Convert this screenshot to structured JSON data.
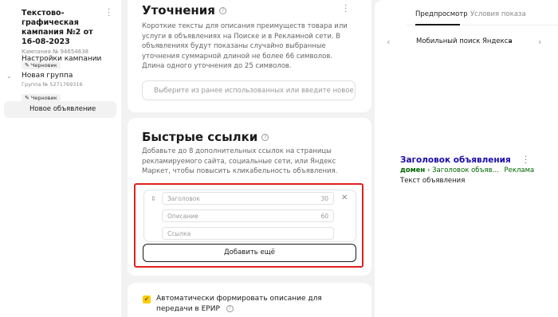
{
  "sidebar": {
    "campaign": {
      "title": "Текстово-графическая кампания №2 от 16-08-2023",
      "id_text": "Кампания № 94654638",
      "status": "Черновик"
    },
    "settings_link": "Настройки кампании",
    "group": {
      "title": "Новая группа",
      "id_text": "Группа № 5271769316",
      "status": "Черновик"
    },
    "new_ad": "Новое объявление"
  },
  "refinements": {
    "title": "Уточнения",
    "description": "Короткие тексты для описания преимуществ товара или услуги в объявлениях на Поиске и в Рекламной сети. В объявлениях будут показаны случайно выбранные уточнения суммарной длиной не более 66 символов. Длина одного уточнения до 25 символов.",
    "input_placeholder": "Выберите из ранее использованных или введите новое"
  },
  "sitelinks": {
    "title": "Быстрые ссылки",
    "description": "Добавьте до 8 дополнительных ссылок на страницы рекламируемого сайта, социальные сети, или Яндекс Маркет, чтобы повысить кликабельность объявления.",
    "fields": {
      "title_placeholder": "Заголовок",
      "title_limit": "30",
      "desc_placeholder": "Описание",
      "desc_limit": "60",
      "link_placeholder": "Ссылка"
    },
    "add_more": "Добавить ещё"
  },
  "erir": {
    "checked": true,
    "label": "Автоматически формировать описание для передачи в ЕРИР"
  },
  "preview": {
    "tabs": [
      "Предпросмотр",
      "Условия показа"
    ],
    "active_tab": 0,
    "device": "Мобильный поиск Яндекса",
    "ad": {
      "title": "Заголовок объявления",
      "domain": "домен",
      "path": "› Заголовок объяв...",
      "label": "Реклама",
      "text": "Текст объявления"
    }
  },
  "colors": {
    "highlight": "#e02020",
    "accent_yellow": "#ffcc00",
    "ad_title": "#1a0dab",
    "ad_green": "#006600"
  }
}
